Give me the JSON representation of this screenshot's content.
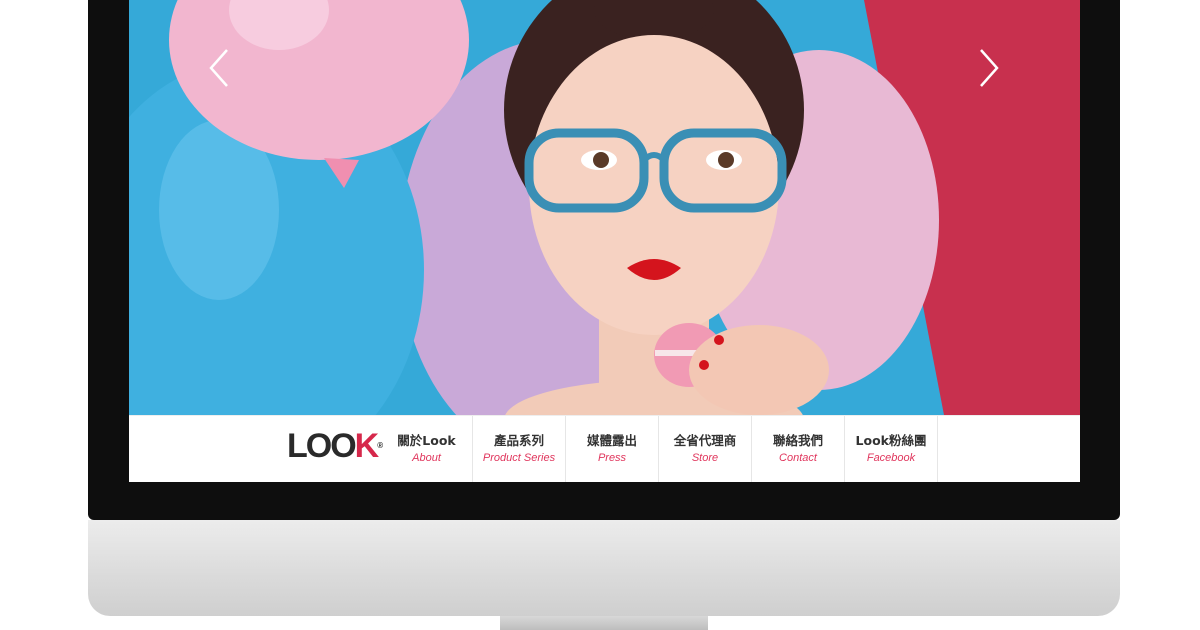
{
  "site": {
    "logo_text": "LOOK",
    "logo_mark": "®"
  },
  "slider": {
    "prev_icon": "chevron-left-icon",
    "next_icon": "chevron-right-icon",
    "colors": {
      "blue": "#35a9d8",
      "magenta": "#c8304e",
      "pink_balloon": "#f2b6cf",
      "lavender_balloon": "#c9a9d8"
    }
  },
  "nav": {
    "items": [
      {
        "zh": "關於Look",
        "en": "About"
      },
      {
        "zh": "產品系列",
        "en": "Product Series"
      },
      {
        "zh": "媒體露出",
        "en": "Press"
      },
      {
        "zh": "全省代理商",
        "en": "Store"
      },
      {
        "zh": "聯絡我們",
        "en": "Contact"
      },
      {
        "zh": "Look粉絲團",
        "en": "Facebook"
      }
    ],
    "accent": "#e0355c"
  }
}
